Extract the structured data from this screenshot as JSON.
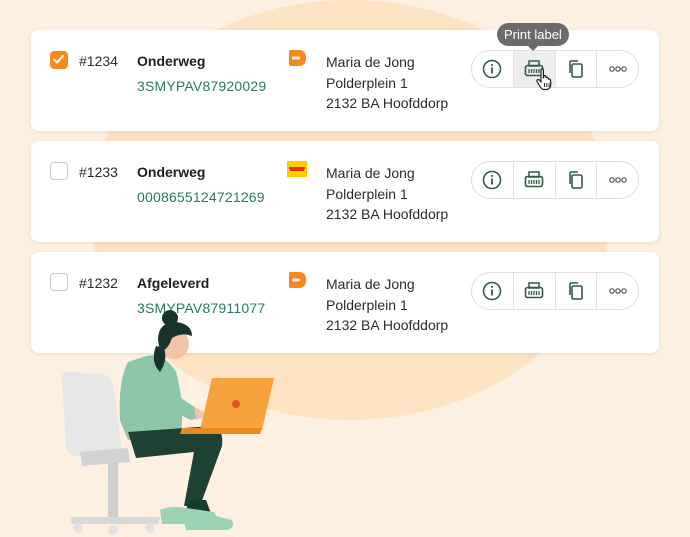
{
  "tooltip": {
    "text": "Print label"
  },
  "actions": {
    "info_icon": "info-circle-icon",
    "print_icon": "printer-icon",
    "copy_icon": "copy-icon",
    "more_icon": "more-dots-icon"
  },
  "colors": {
    "accent": "#f5881f",
    "tracking": "#2c7a55",
    "background": "#fdf0e1"
  },
  "orders": [
    {
      "checked": true,
      "number": "#1234",
      "status": "Onderweg",
      "tracking": "3SMYPAV87920029",
      "carrier": "postnl",
      "address": [
        "Maria de Jong",
        "Polderplein 1",
        "2132 BA Hoofddorp"
      ]
    },
    {
      "checked": false,
      "number": "#1233",
      "status": "Onderweg",
      "tracking": "0008655124721269",
      "carrier": "dhl",
      "address": [
        "Maria de Jong",
        "Polderplein 1",
        "2132 BA Hoofddorp"
      ]
    },
    {
      "checked": false,
      "number": "#1232",
      "status": "Afgeleverd",
      "tracking": "3SMYPAV87911077",
      "carrier": "postnl",
      "address": [
        "Maria de Jong",
        "Polderplein 1",
        "2132 BA Hoofddorp"
      ]
    }
  ]
}
